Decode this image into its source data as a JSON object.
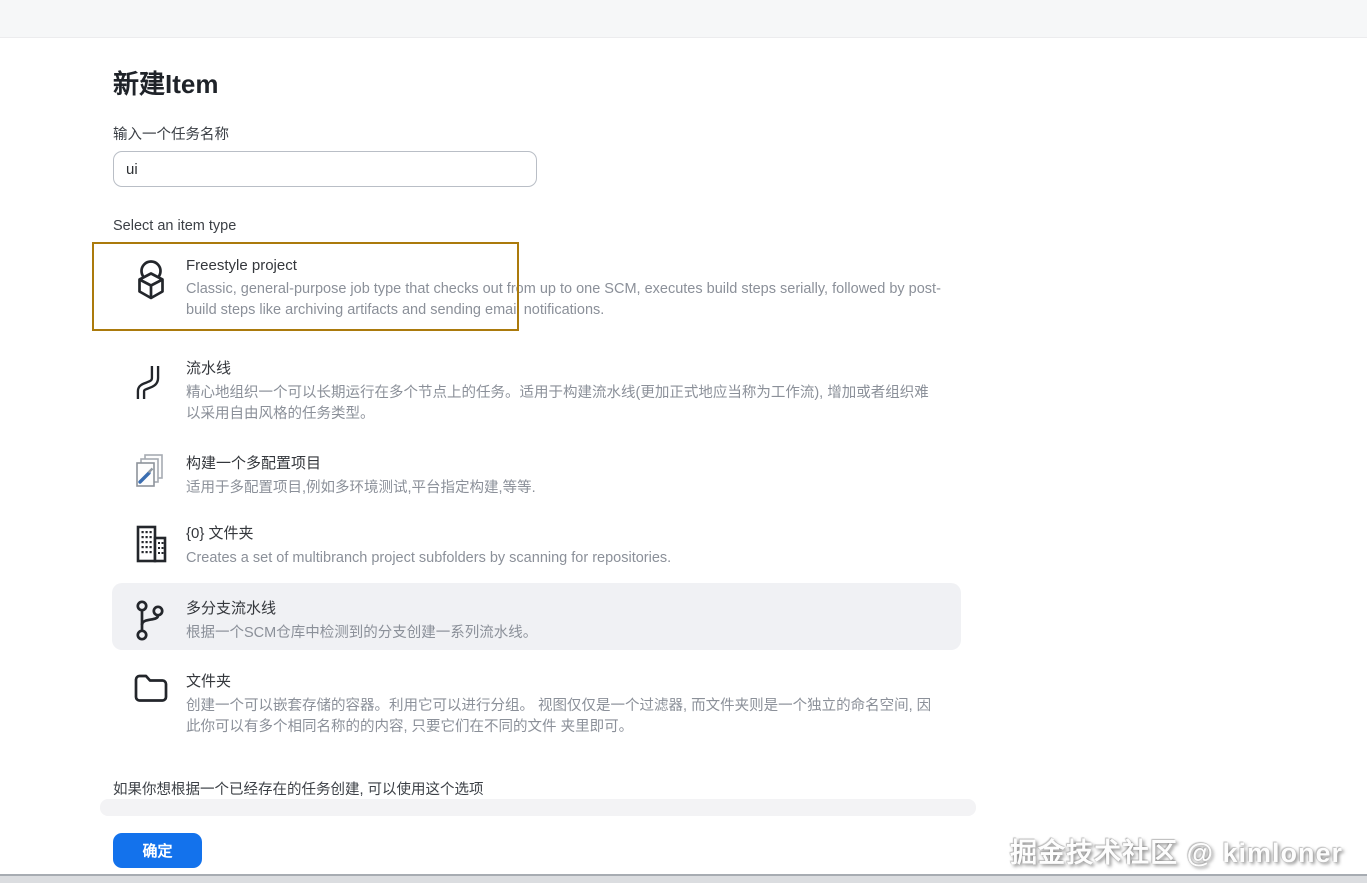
{
  "page": {
    "title": "新建Item"
  },
  "form": {
    "name_label": "输入一个任务名称",
    "name_value": "ui",
    "type_label": "Select an item type"
  },
  "items": [
    {
      "icon": "freestyle-project-icon",
      "title": "Freestyle project",
      "desc": "Classic, general-purpose job type that checks out from up to one SCM, executes build steps serially, followed by post-build steps like archiving artifacts and sending email notifications.",
      "selected": true
    },
    {
      "icon": "pipeline-icon",
      "title": "流水线",
      "desc": "精心地组织一个可以长期运行在多个节点上的任务。适用于构建流水线(更加正式地应当称为工作流), 增加或者组织难以采用自由风格的任务类型。"
    },
    {
      "icon": "multiconfiguration-icon",
      "title": "构建一个多配置项目",
      "desc": "适用于多配置项目,例如多环境测试,平台指定构建,等等."
    },
    {
      "icon": "organization-folder-icon",
      "title": "{0} 文件夹",
      "desc": "Creates a set of multibranch project subfolders by scanning for repositories."
    },
    {
      "icon": "multibranch-pipeline-icon",
      "title": "多分支流水线",
      "desc": "根据一个SCM仓库中检测到的分支创建一系列流水线。",
      "highlighted_row": true
    },
    {
      "icon": "folder-icon",
      "title": "文件夹",
      "desc": "创建一个可以嵌套存储的容器。利用它可以进行分组。 视图仅仅是一个过滤器, 而文件夹则是一个独立的命名空间, 因此你可以有多个相同名称的的内容, 只要它们在不同的文件 夹里即可。"
    }
  ],
  "footer": {
    "hint": "如果你想根据一个已经存在的任务创建, 可以使用这个选项",
    "ok_label": "确定"
  },
  "watermark": "掘金技术社区 @ kimloner",
  "colors": {
    "highlight_border": "#ab7a0c",
    "primary_button": "#1372ec",
    "selected_row_bg": "#f0f1f4"
  }
}
